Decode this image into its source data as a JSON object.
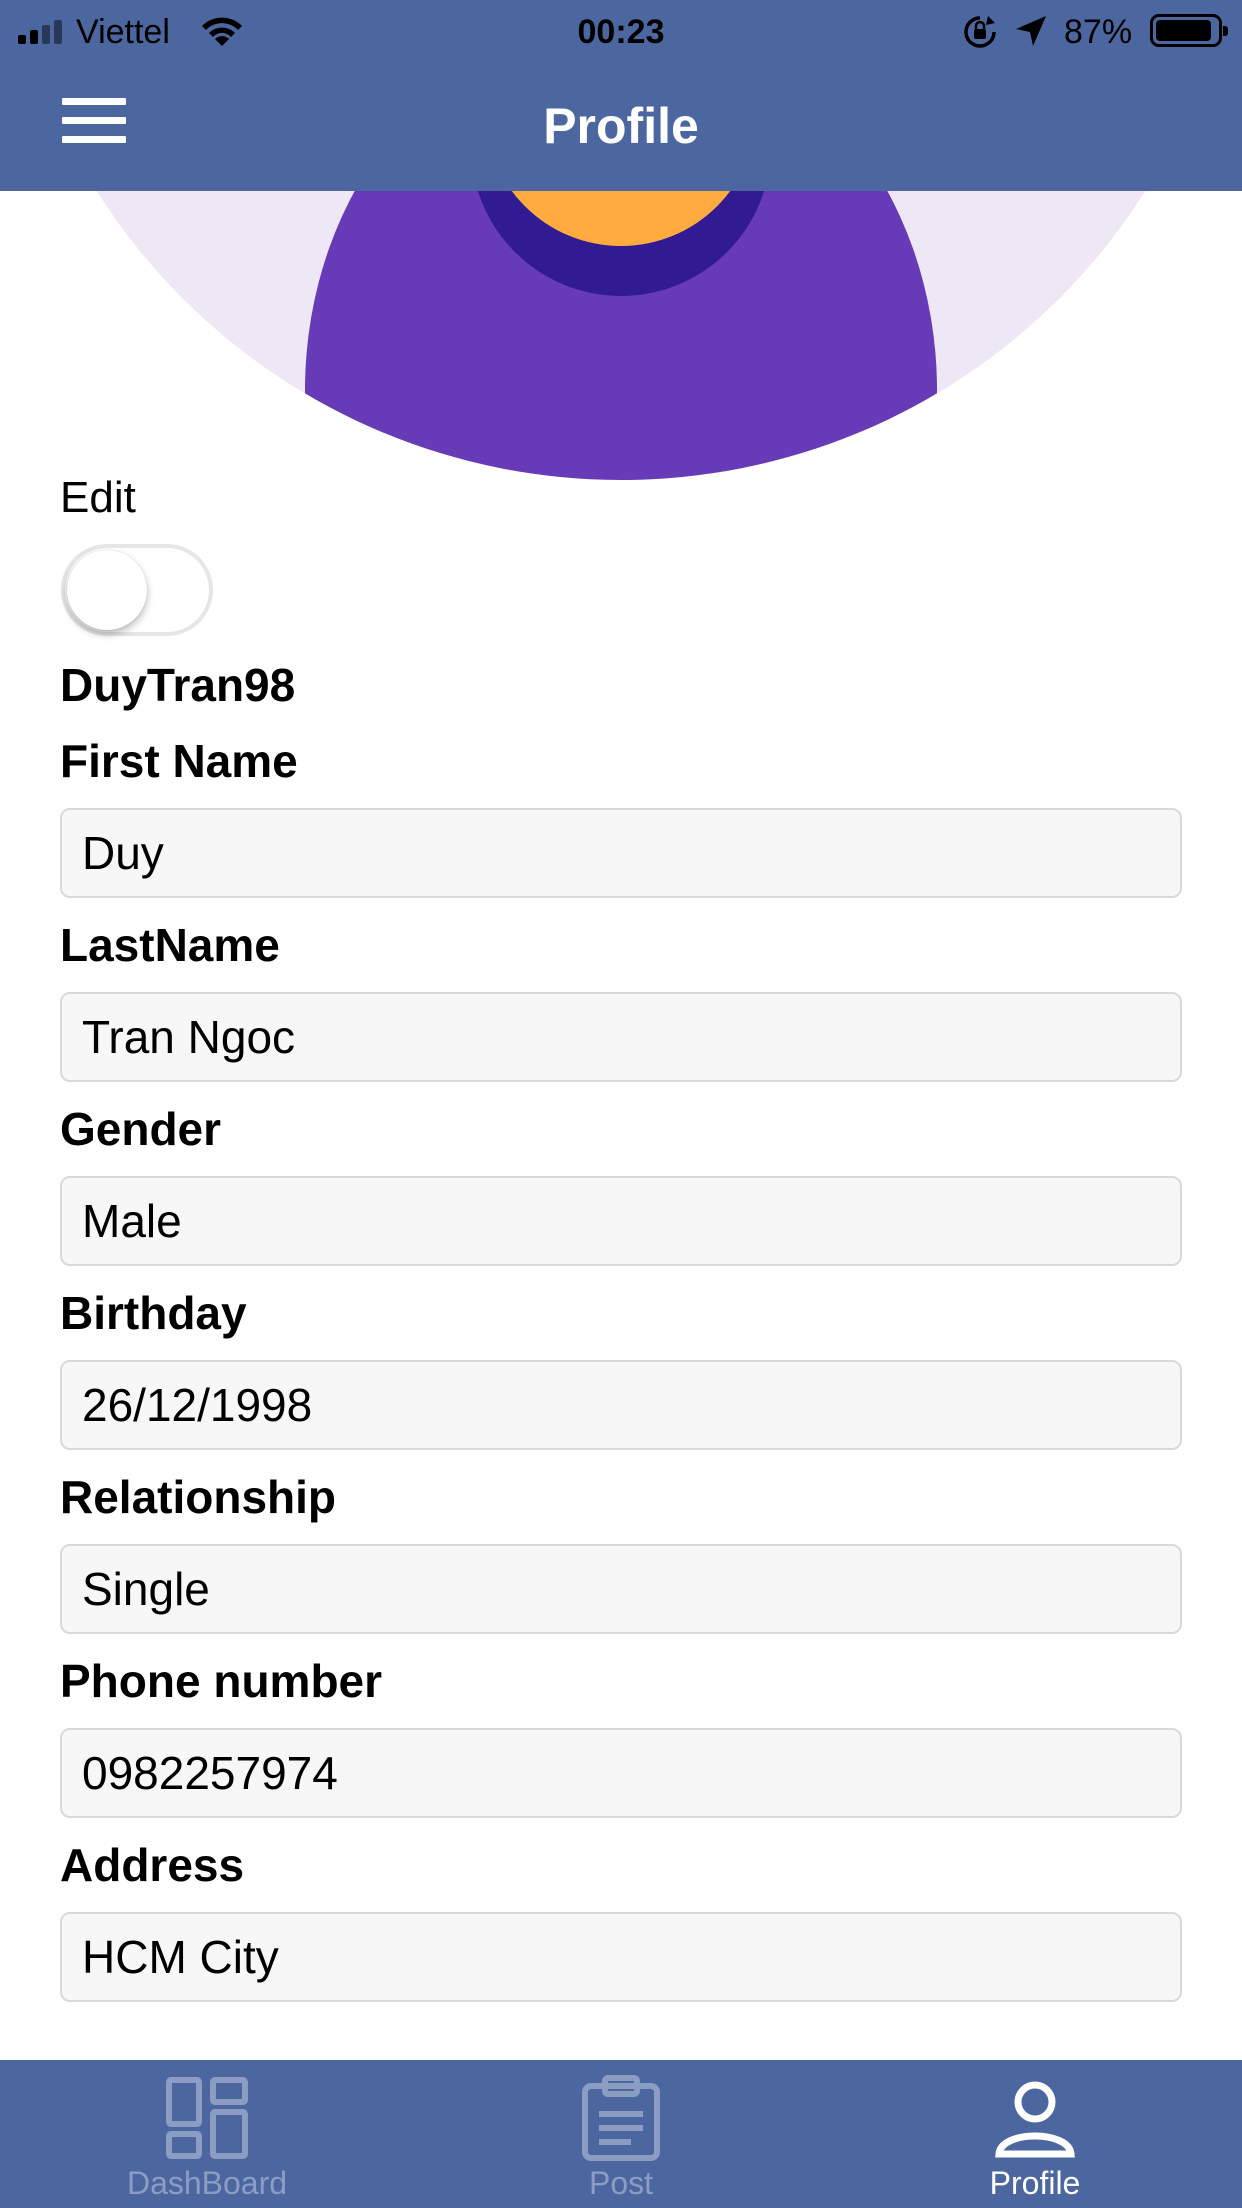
{
  "status_bar": {
    "carrier": "Viettel",
    "time": "00:23",
    "battery_percent": "87%",
    "battery_level": 0.87
  },
  "header": {
    "title": "Profile",
    "menu_icon": "hamburger-menu-icon"
  },
  "avatar": {
    "icon": "user-avatar-illustration",
    "colors": {
      "background": "#EEE7F6",
      "body": "#673AB7",
      "collar": "#311B92",
      "face": "#FFAB40"
    }
  },
  "edit": {
    "label": "Edit",
    "enabled": false
  },
  "username": "DuyTran98",
  "fields": [
    {
      "label": "First Name",
      "value": "Duy"
    },
    {
      "label": "LastName",
      "value": "Tran Ngoc"
    },
    {
      "label": "Gender",
      "value": "Male"
    },
    {
      "label": "Birthday",
      "value": "26/12/1998"
    },
    {
      "label": "Relationship",
      "value": "Single"
    },
    {
      "label": "Phone number",
      "value": "0982257974"
    },
    {
      "label": "Address",
      "value": "HCM City"
    }
  ],
  "tabbar": {
    "tabs": [
      {
        "label": "DashBoard",
        "icon": "dashboard-icon",
        "active": false
      },
      {
        "label": "Post",
        "icon": "clipboard-icon",
        "active": false
      },
      {
        "label": "Profile",
        "icon": "user-icon",
        "active": true
      }
    ]
  },
  "colors": {
    "header_bg": "#4C66A0",
    "tab_inactive": "#8C9DC4",
    "tab_active": "#FFFFFF"
  }
}
